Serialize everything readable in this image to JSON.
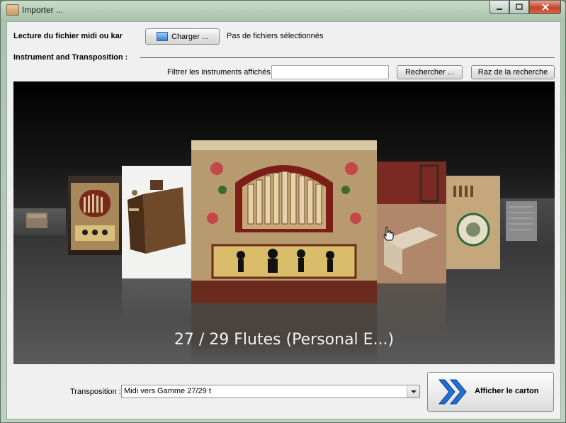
{
  "window": {
    "title": "Importer ..."
  },
  "file_section": {
    "label": "Lecture du fichier midi ou kar",
    "load_button": "Charger ...",
    "status": "Pas de fichiers sélectionnés"
  },
  "instrument_section": {
    "label": "Instrument and Transposition :",
    "filter_label": "Filtrer les instruments affichés :",
    "filter_value": "",
    "search_button": "Rechercher ...",
    "reset_button": "Raz de la recherche"
  },
  "viewer": {
    "selected_caption": "27 / 29 Flutes (Personal E...)"
  },
  "transposition": {
    "label": "Transposition :",
    "selected": "Midi vers Gamme 27/29 t"
  },
  "action": {
    "show_card_button": "Afficher le carton"
  },
  "colors": {
    "accent_blue": "#1f6fd6",
    "viewer_bg": "#1a1a1a"
  }
}
